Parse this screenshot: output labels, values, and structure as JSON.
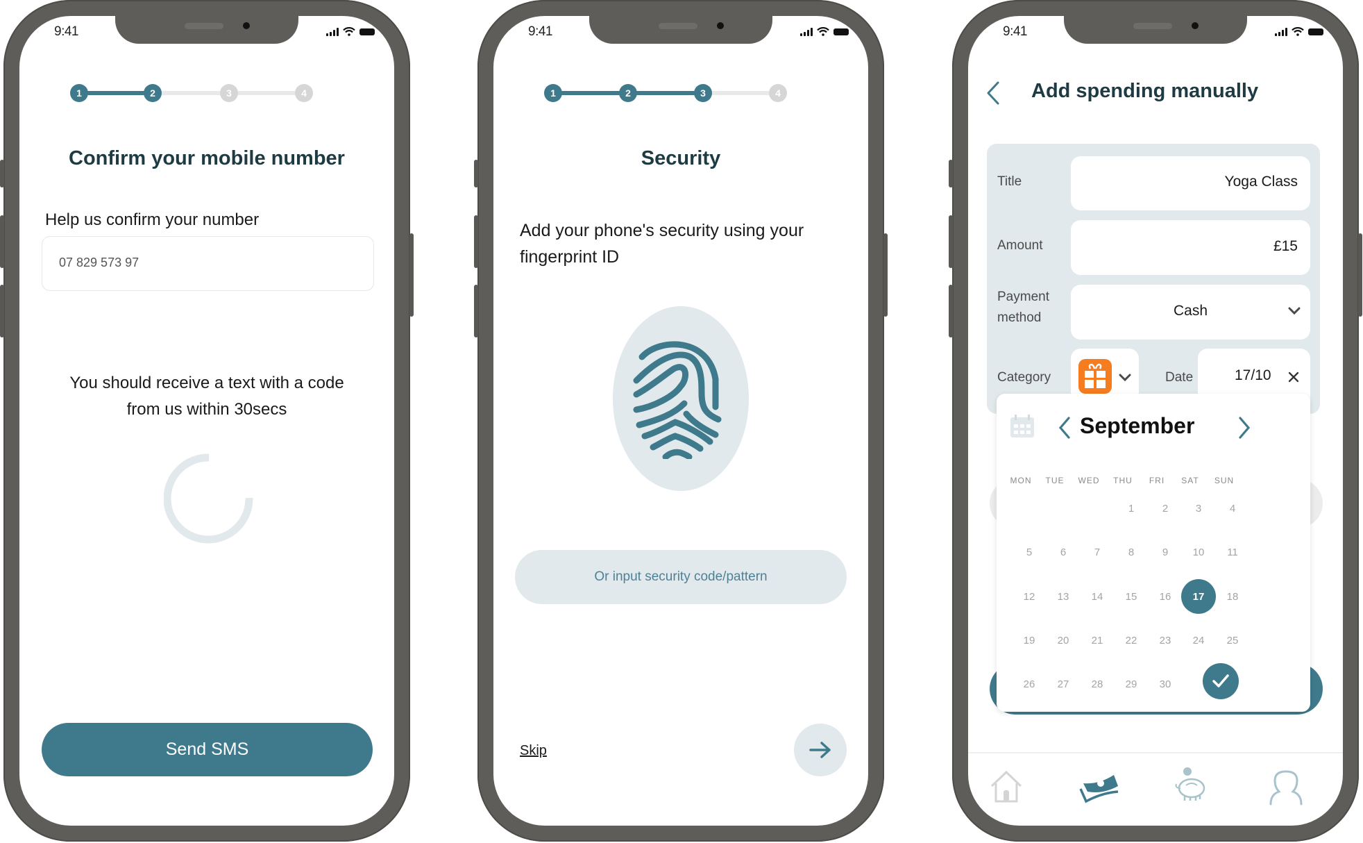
{
  "status_bar": {
    "time": "9:41"
  },
  "colors": {
    "accent": "#3f7a8c",
    "light_accent": "#e1e9ec",
    "title": "#1e3a42",
    "category_orange": "#f57c1f"
  },
  "screen1": {
    "stepper": {
      "steps": [
        "1",
        "2",
        "3",
        "4"
      ],
      "current_step": 2
    },
    "title": "Confirm your mobile number",
    "field_label": "Help us confirm your number",
    "phone_value": "07 829 573 97",
    "info_text_line1": "You should receive a text with a code",
    "info_text_line2": "from us within 30secs",
    "spinner_icon": "loading-spinner",
    "button_label": "Send SMS"
  },
  "screen2": {
    "stepper": {
      "steps": [
        "1",
        "2",
        "3",
        "4"
      ],
      "current_step": 3
    },
    "title": "Security",
    "description_line1": "Add your phone's security using your",
    "description_line2": "fingerprint ID",
    "fingerprint_icon": "fingerprint",
    "alt_button_label": "Or input security code/pattern",
    "skip_label": "Skip",
    "next_icon": "arrow-right"
  },
  "screen3": {
    "back_icon": "chevron-left",
    "title": "Add spending manually",
    "form": {
      "title_label": "Title",
      "title_value": "Yoga Class",
      "amount_label": "Amount",
      "amount_value": "£15",
      "payment_label_line1": "Payment",
      "payment_label_line2": "method",
      "payment_value": "Cash",
      "category_label": "Category",
      "category_icon": "gift",
      "date_label": "Date",
      "date_value": "17/10",
      "clear_icon": "close"
    },
    "calendar": {
      "month": "September",
      "weekdays": [
        "MON",
        "TUE",
        "WED",
        "THU",
        "FRI",
        "SAT",
        "SUN"
      ],
      "weeks": [
        [
          "",
          "",
          "",
          "1",
          "2",
          "3",
          "4"
        ],
        [
          "5",
          "6",
          "7",
          "8",
          "9",
          "10",
          "11"
        ],
        [
          "12",
          "13",
          "14",
          "15",
          "16",
          "17",
          "18"
        ],
        [
          "19",
          "20",
          "21",
          "22",
          "23",
          "24",
          "25"
        ],
        [
          "26",
          "27",
          "28",
          "29",
          "30",
          "",
          ""
        ]
      ],
      "selected_day": "17",
      "confirm_icon": "checkmark"
    },
    "bottom_nav": [
      {
        "icon": "home",
        "active": false
      },
      {
        "icon": "money",
        "active": true
      },
      {
        "icon": "piggy-bank",
        "active": false
      },
      {
        "icon": "user",
        "active": false
      }
    ]
  }
}
